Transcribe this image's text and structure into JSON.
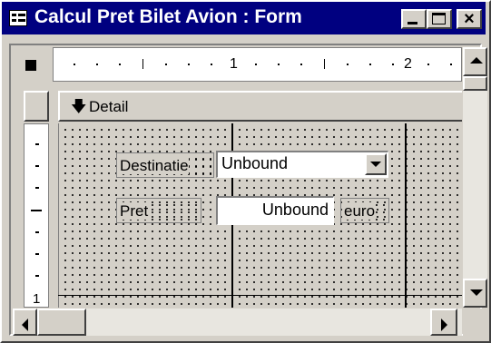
{
  "window": {
    "title": "Calcul Pret Bilet Avion : Form",
    "icon": "form-icon",
    "controls": {
      "minimize": "minimize-icon",
      "maximize": "maximize-icon",
      "close": "×"
    }
  },
  "ruler": {
    "horizontal_numbers": [
      "1",
      "2"
    ],
    "vertical_numbers": [
      "1"
    ]
  },
  "section": {
    "label": "Detail",
    "icon": "arrow-down-icon"
  },
  "fields": {
    "destinatie": {
      "label": "Destinatie",
      "value": "Unbound"
    },
    "pret": {
      "label": "Pret",
      "value": "Unbound",
      "unit": "euro"
    }
  },
  "colors": {
    "titlebar": "#000080",
    "face": "#d4d0c8"
  }
}
